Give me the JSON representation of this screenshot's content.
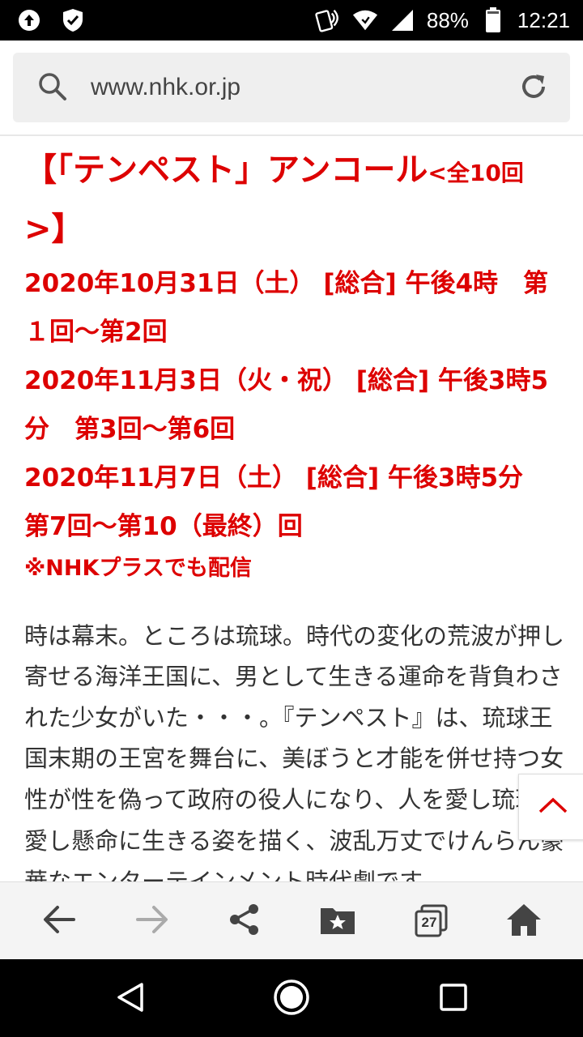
{
  "status_bar": {
    "battery": "88%",
    "time": "12:21",
    "icons": [
      "upload-icon",
      "shield-icon",
      "nfc-icon",
      "wifi-icon",
      "signal-icon",
      "battery-icon"
    ]
  },
  "url_bar": {
    "url": "www.nhk.or.jp",
    "icons": [
      "search-icon",
      "reload-icon"
    ]
  },
  "article": {
    "title_line1": "【「テンペスト」アンコール",
    "title_small": "<全10回",
    "title_line2": ">】",
    "schedule": [
      "2020年10月31日（土） [総合] 午後4時　第",
      "１回～第2回",
      "2020年11月3日（火・祝） [総合] 午後3時5",
      "分　第3回～第6回",
      "2020年11月7日（土） [総合] 午後3時5分",
      "第7回～第10（最終）回"
    ],
    "note": "※NHKプラスでも配信",
    "paragraph": [
      "時は幕末。ところは琉球。時代の変化の荒波が押し",
      "寄せる海洋王国に、男として生きる運命を背負わさ",
      "れた少女がいた・・・。『テンペスト』は、琉球王",
      "国末期の王宮を舞台に、美ぼうと才能を併せ持つ女",
      "性が性を偽って政府の役人になり、人を愛し琉球を",
      "愛し懸命に生きる姿を描く、波乱万丈でけんらん豪",
      "華なエンターテインメント時代劇です。"
    ]
  },
  "scroll_top": {
    "icon": "chevron-up-icon"
  },
  "toolbar": {
    "tabs_count": "27",
    "icons": [
      "back-arrow-icon",
      "forward-arrow-icon",
      "share-icon",
      "bookmark-folder-icon",
      "tabs-icon",
      "home-icon"
    ]
  },
  "navbar": {
    "icons": [
      "nav-back-icon",
      "nav-home-icon",
      "nav-recents-icon"
    ]
  },
  "colors": {
    "accent_red": "#dd0000",
    "body_text": "#333333",
    "status_bg": "#000000"
  }
}
